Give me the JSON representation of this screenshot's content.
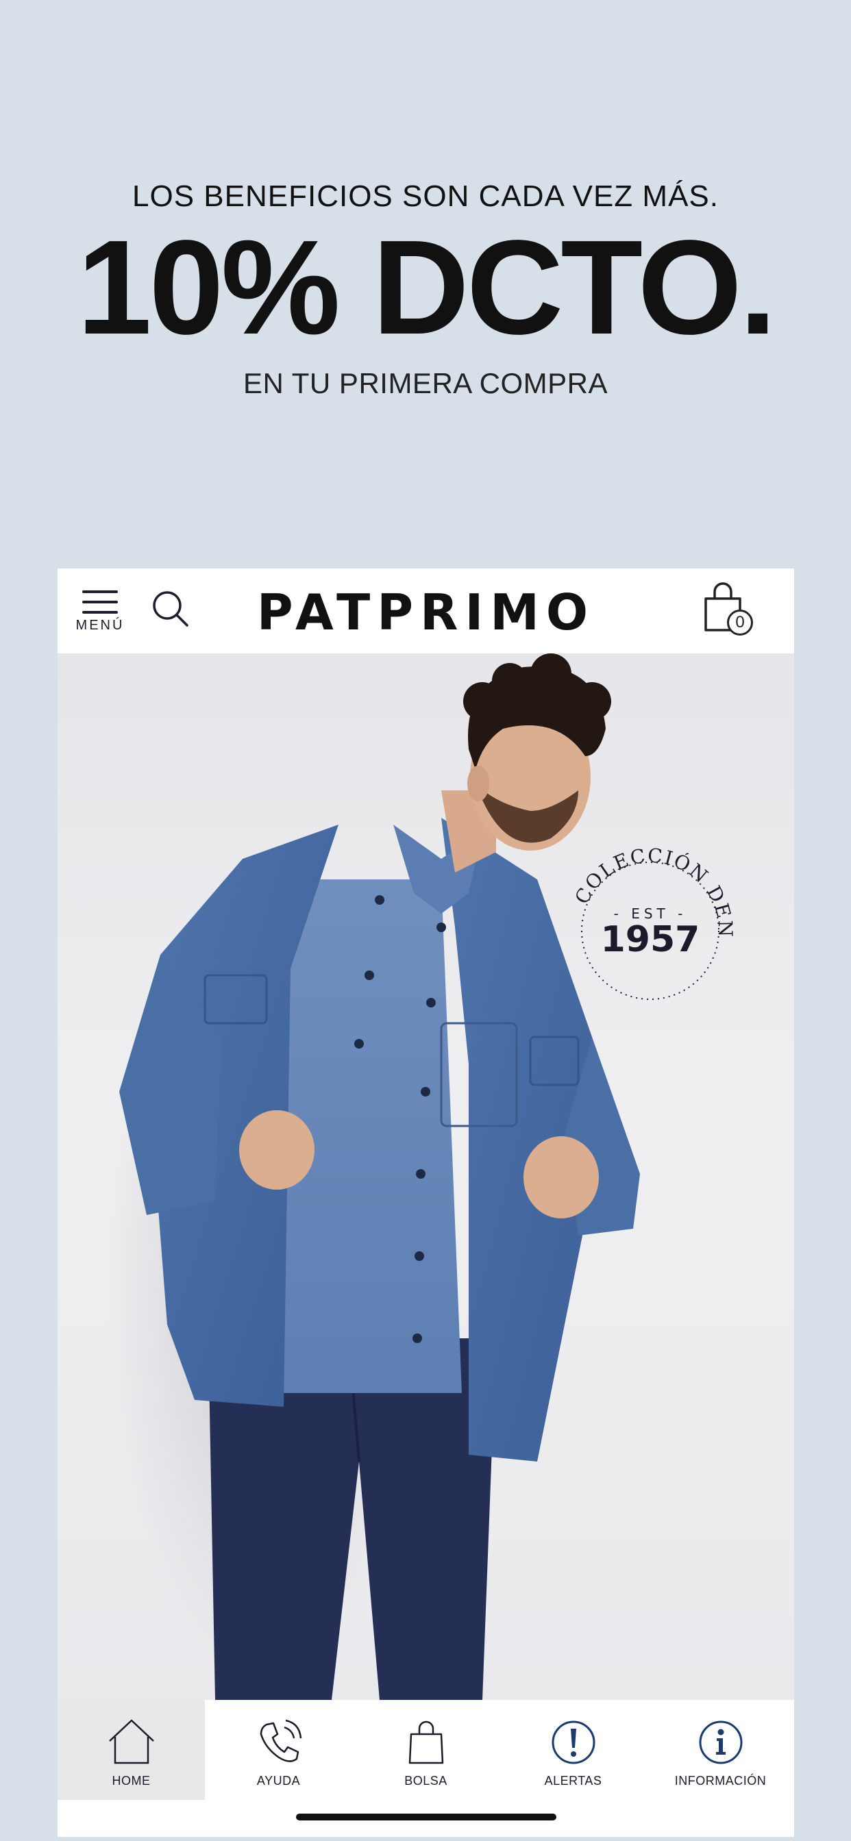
{
  "promo": {
    "line1": "LOS BENEFICIOS SON CADA VEZ MÁS.",
    "headline": "10% DCTO.",
    "line3": "EN TU PRIMERA COMPRA"
  },
  "header": {
    "menu_label": "MENÚ",
    "logo": "PATPRIMO",
    "bag_count": "0"
  },
  "hero": {
    "stamp_top": "COLECCIÓN DENIM",
    "stamp_est": "- EST -",
    "stamp_year": "1957"
  },
  "nav": {
    "tabs": [
      {
        "label": "HOME",
        "icon": "home-icon",
        "active": true
      },
      {
        "label": "AYUDA",
        "icon": "phone-icon",
        "active": false
      },
      {
        "label": "BOLSA",
        "icon": "bag-icon",
        "active": false
      },
      {
        "label": "ALERTAS",
        "icon": "alert-icon",
        "active": false
      },
      {
        "label": "INFORMACIÓN",
        "icon": "info-icon",
        "active": false
      }
    ]
  },
  "colors": {
    "background": "#d7dfe9",
    "ink": "#1b1b2c",
    "denim": "#4a6fa5",
    "jeans": "#252f55"
  }
}
